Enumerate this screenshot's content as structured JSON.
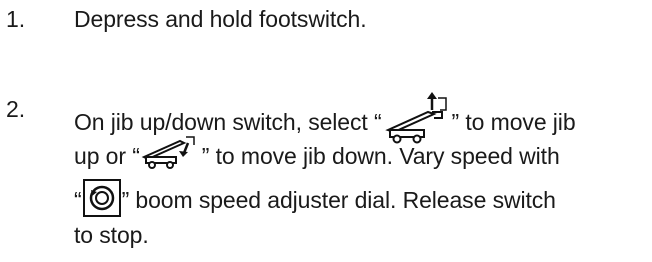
{
  "steps": [
    {
      "number": "1.",
      "text": "Depress and hold footswitch."
    },
    {
      "number": "2.",
      "line1_pre": "On jib up/down switch, select “",
      "line1_post": "” to move jib",
      "line2_pre": "up or “",
      "line2_post": "” to move jib down. Vary speed with",
      "line3_pre": "“",
      "line3_post": "” boom speed adjuster dial. Release switch",
      "line4": "to stop."
    }
  ],
  "icons": {
    "jib_up": "jib-up-icon",
    "jib_down": "jib-down-icon",
    "speed_dial": "boom-speed-dial-icon"
  }
}
